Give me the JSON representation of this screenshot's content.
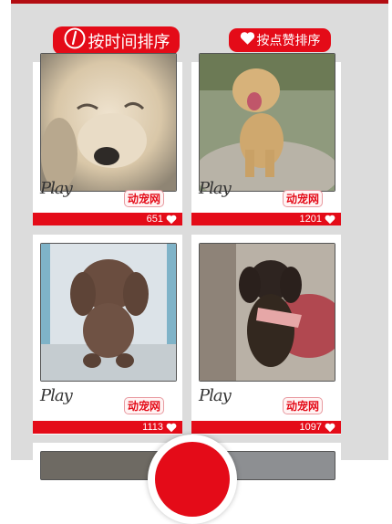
{
  "sort": {
    "time_label": "按时间排序",
    "like_label": "按点赞排序"
  },
  "cards": [
    {
      "play_label": "Play",
      "brand_label": "动宠网",
      "likes": "651"
    },
    {
      "play_label": "Play",
      "brand_label": "动宠网",
      "likes": "1201"
    },
    {
      "play_label": "Play",
      "brand_label": "动宠网",
      "likes": "1113"
    },
    {
      "play_label": "Play",
      "brand_label": "动宠网",
      "likes": "1097"
    }
  ],
  "colors": {
    "accent": "#e40b18",
    "panel_bg": "#dcdcdc",
    "top_bar": "#b30d12"
  },
  "icons": [
    "clock-icon",
    "heart-icon"
  ]
}
